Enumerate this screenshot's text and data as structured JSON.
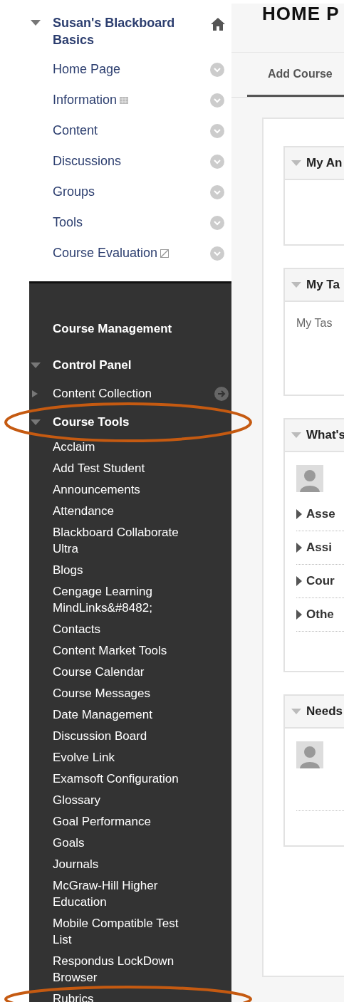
{
  "course_menu": {
    "title": "Susan's Blackboard Basics",
    "expanded": true,
    "items": [
      {
        "label": "Home Page",
        "kind": "plain"
      },
      {
        "label": "Information",
        "kind": "grid"
      },
      {
        "label": "Content",
        "kind": "plain"
      },
      {
        "label": "Discussions",
        "kind": "plain"
      },
      {
        "label": "Groups",
        "kind": "plain"
      },
      {
        "label": "Tools",
        "kind": "plain"
      },
      {
        "label": "Course Evaluation",
        "kind": "slashed"
      }
    ]
  },
  "control_panel": {
    "heading": "Course Management",
    "label": "Control Panel",
    "expanded": true,
    "children": [
      {
        "label": "Content Collection",
        "expanded": false,
        "highlighted": false,
        "go_icon": true
      },
      {
        "label": "Course Tools",
        "expanded": true,
        "highlighted": true,
        "go_icon": false,
        "children": [
          {
            "label": "Acclaim",
            "highlighted": false
          },
          {
            "label": "Add Test Student",
            "highlighted": false
          },
          {
            "label": "Announcements",
            "highlighted": false
          },
          {
            "label": "Attendance",
            "highlighted": false
          },
          {
            "label": "Blackboard Collaborate Ultra",
            "highlighted": false
          },
          {
            "label": "Blogs",
            "highlighted": false
          },
          {
            "label": "Cengage Learning MindLinks&#8482;",
            "highlighted": false
          },
          {
            "label": "Contacts",
            "highlighted": false
          },
          {
            "label": "Content Market Tools",
            "highlighted": false
          },
          {
            "label": "Course Calendar",
            "highlighted": false
          },
          {
            "label": "Course Messages",
            "highlighted": false
          },
          {
            "label": "Date Management",
            "highlighted": false
          },
          {
            "label": "Discussion Board",
            "highlighted": false
          },
          {
            "label": "Evolve Link",
            "highlighted": false
          },
          {
            "label": "Examsoft Configuration",
            "highlighted": false
          },
          {
            "label": "Glossary",
            "highlighted": false
          },
          {
            "label": "Goal Performance",
            "highlighted": false
          },
          {
            "label": "Goals",
            "highlighted": false
          },
          {
            "label": "Journals",
            "highlighted": false
          },
          {
            "label": "McGraw-Hill Higher Education",
            "highlighted": false
          },
          {
            "label": "Mobile Compatible Test List",
            "highlighted": false
          },
          {
            "label": "Respondus LockDown Browser",
            "highlighted": false
          },
          {
            "label": "Rubrics",
            "highlighted": true
          }
        ]
      }
    ]
  },
  "page_title": "HOME P",
  "tabs": [
    {
      "label": "Add Course",
      "selected": true
    }
  ],
  "modules": [
    {
      "title": "My An",
      "expanded": true,
      "kind": "empty"
    },
    {
      "title": "My Ta",
      "expanded": true,
      "kind": "text",
      "text": "My Tas"
    },
    {
      "title": "What's",
      "expanded": true,
      "kind": "feed",
      "rows": [
        {
          "label": "Asse",
          "expanded": false
        },
        {
          "label": "Assi",
          "expanded": false
        },
        {
          "label": "Cour",
          "expanded": false
        },
        {
          "label": "Othe",
          "expanded": false
        }
      ]
    },
    {
      "title": "Needs",
      "expanded": true,
      "kind": "avatar"
    }
  ]
}
